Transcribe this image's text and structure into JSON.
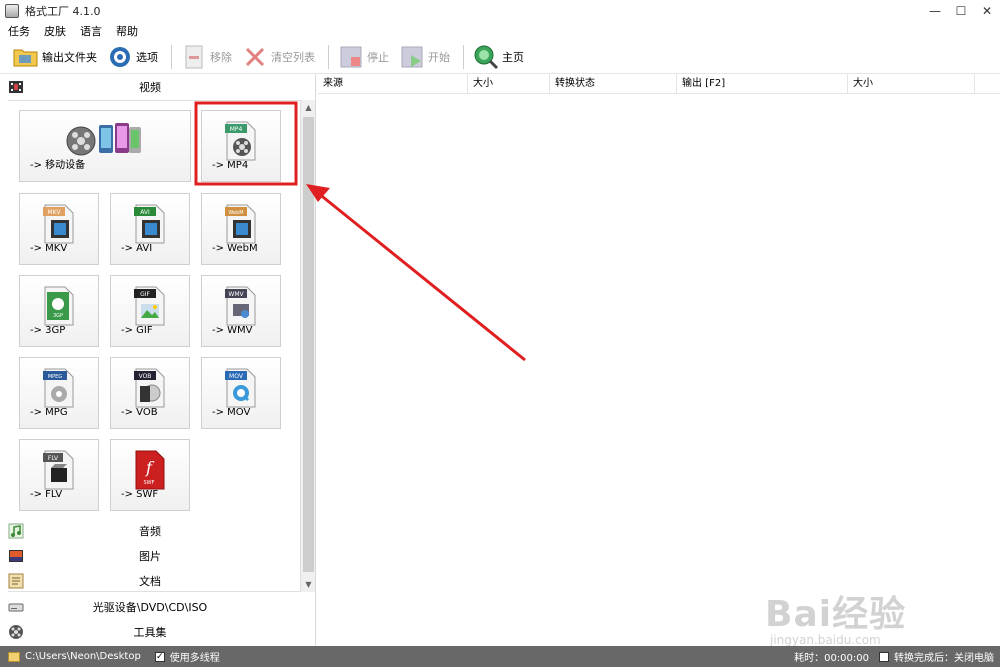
{
  "window": {
    "title": "格式工厂 4.1.0",
    "controls": [
      "—",
      "☐",
      "✕"
    ]
  },
  "menu": [
    "任务",
    "皮肤",
    "语言",
    "帮助"
  ],
  "toolbar": {
    "output_folder": "输出文件夹",
    "options": "选项",
    "remove": "移除",
    "clear_list": "清空列表",
    "stop": "停止",
    "start": "开始",
    "home": "主页"
  },
  "left": {
    "video_label": "视频",
    "tiles": [
      {
        "label": "-> 移动设备",
        "icon": "mobile-device-icon"
      },
      {
        "label": "-> MP4",
        "icon": "mp4-file-icon",
        "badge": "MP4"
      },
      {
        "label": "-> MKV",
        "icon": "mkv-file-icon",
        "badge": "MKV"
      },
      {
        "label": "-> AVI",
        "icon": "avi-file-icon",
        "badge": "AVI"
      },
      {
        "label": "-> WebM",
        "icon": "webm-file-icon",
        "badge": "WebM"
      },
      {
        "label": "-> 3GP",
        "icon": "3gp-file-icon",
        "badge": "3GP"
      },
      {
        "label": "-> GIF",
        "icon": "gif-file-icon",
        "badge": "GIF"
      },
      {
        "label": "-> WMV",
        "icon": "wmv-file-icon",
        "badge": "WMV"
      },
      {
        "label": "-> MPG",
        "icon": "mpg-file-icon",
        "badge": "MPEG"
      },
      {
        "label": "-> VOB",
        "icon": "vob-file-icon",
        "badge": "VOB"
      },
      {
        "label": "-> MOV",
        "icon": "mov-file-icon",
        "badge": "MOV"
      },
      {
        "label": "-> FLV",
        "icon": "flv-file-icon",
        "badge": "FLV"
      },
      {
        "label": "-> SWF",
        "icon": "swf-file-icon",
        "badge": "SWF"
      }
    ],
    "categories": [
      "音频",
      "图片",
      "文档",
      "光驱设备\\DVD\\CD\\ISO",
      "工具集"
    ]
  },
  "table": {
    "columns": [
      "来源",
      "大小",
      "转换状态",
      "输出 [F2]",
      "大小"
    ]
  },
  "status": {
    "path": "C:\\Users\\Neon\\Desktop",
    "multithread": "使用多线程",
    "time": "耗时：00:00:00",
    "after_done": "转换完成后：关闭电脑"
  },
  "watermark": {
    "brand": "Bai经验",
    "url": "jingyan.baidu.com"
  },
  "colors": {
    "highlight": "#e02020",
    "statusbar": "#686868",
    "flash_red": "#cc2020"
  }
}
